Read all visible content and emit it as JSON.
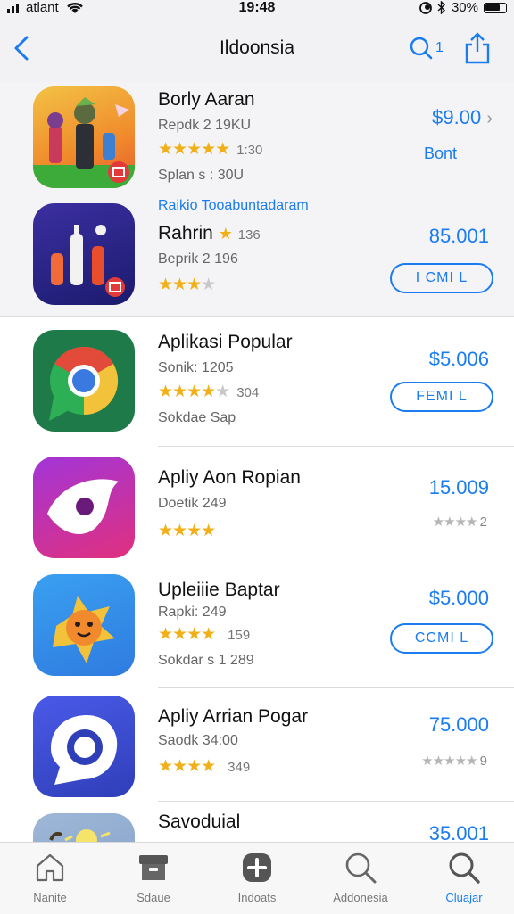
{
  "status_bar": {
    "carrier": "atlant",
    "time": "19:48",
    "battery": "30%"
  },
  "nav": {
    "title": "Ildoonsia",
    "search_badge": "1"
  },
  "apps": [
    {
      "name": "Borly Aaran",
      "line1": "Repdk 2 19KU",
      "rating_count": "1:30",
      "line3": "Splan s : 30U",
      "price": "$9.00",
      "action_text": "Bont",
      "rating_level": 0.9
    },
    {
      "section_link": "Raikio Tooabuntadaram",
      "name": "Rahrin",
      "name_count": "136",
      "line1": "Beprik 2 196",
      "price": "85.001",
      "action_button": "I CMI L",
      "rating_level": 0.8
    },
    {
      "name": "Aplikasi Popular",
      "line1": "Sonik: 1205",
      "rating_count": "304",
      "line3": "Sokdae Sap",
      "price": "$5.006",
      "action_button": "FEMI L",
      "rating_level": 0.8
    },
    {
      "name": "Apliy Aon Ropian",
      "line1": "Doetik 249",
      "price": "15.009",
      "small_rating": "2",
      "rating_level": 0.8
    },
    {
      "name": "Upleiiie Baptar",
      "line1": "Rapki: 249",
      "rating_count": "159",
      "line3": "Sokdar s 1 289",
      "price": "$5.000",
      "action_button": "CCMI L",
      "rating_level": 0.8
    },
    {
      "name": "Apliy Arrian Pogar",
      "line1": "Saodk 34:00",
      "rating_count": "349",
      "price": "75.000",
      "small_rating": "9",
      "rating_level": 0.8
    },
    {
      "name": "Savoduial",
      "price": "35.001"
    }
  ],
  "tabs": [
    {
      "label": "Nanite",
      "icon": "home-icon",
      "active": false
    },
    {
      "label": "Sdaue",
      "icon": "box-icon",
      "active": false
    },
    {
      "label": "Indoats",
      "icon": "plus-icon",
      "active": false
    },
    {
      "label": "Addonesia",
      "icon": "search-icon",
      "active": false
    },
    {
      "label": "Cluajar",
      "icon": "search-icon",
      "active": true
    }
  ],
  "colors": {
    "accent": "#1a7cf0",
    "star": "#f2b018"
  }
}
